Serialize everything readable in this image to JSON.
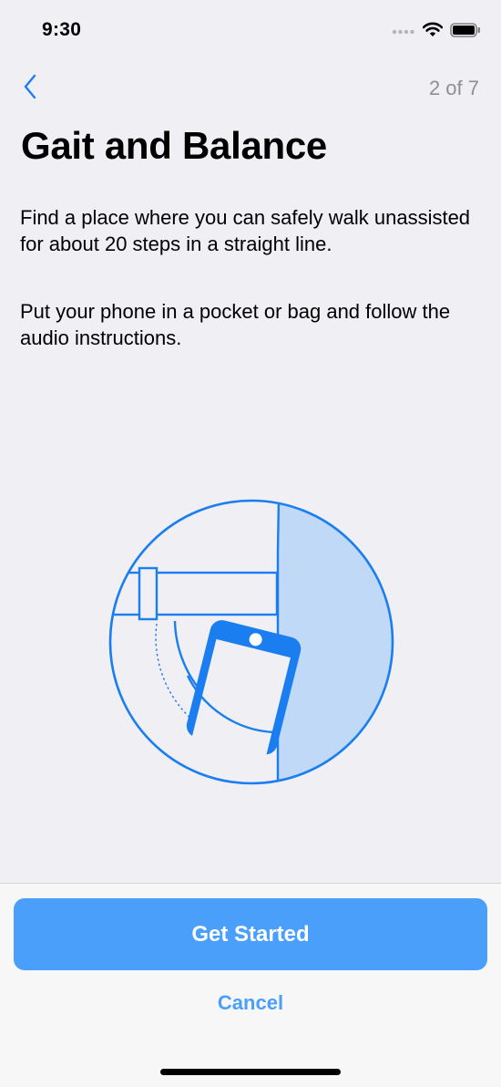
{
  "status_bar": {
    "time": "9:30"
  },
  "nav": {
    "back_icon": "chevron-left-icon",
    "step_indicator": "2 of 7"
  },
  "content": {
    "title": "Gait and Balance",
    "paragraphs": [
      "Find a place where you can safely walk unassisted for about 20 steps in a straight line.",
      "Put your phone in a pocket or bag and follow the audio instructions."
    ],
    "illustration_icon": "phone-in-pocket-illustration"
  },
  "footer": {
    "primary_button": "Get Started",
    "cancel_button": "Cancel"
  },
  "colors": {
    "accent": "#4a9ffa",
    "illustration_stroke": "#1a7ef0",
    "illustration_fill": "#bfd9f6",
    "background": "#efeff4"
  }
}
